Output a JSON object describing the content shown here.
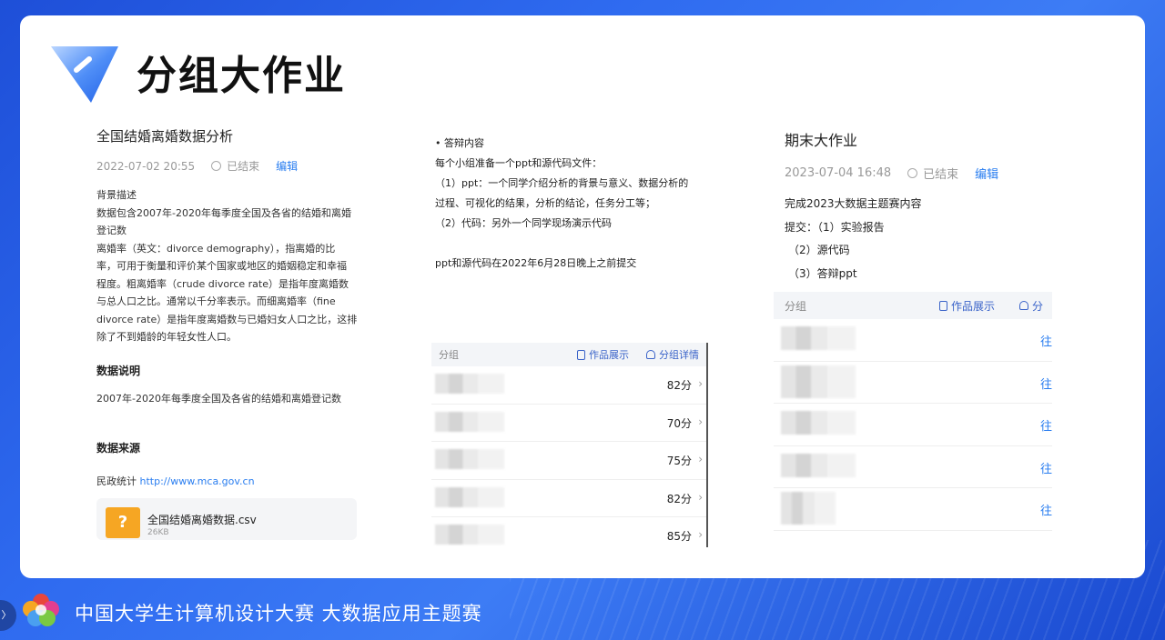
{
  "slide": {
    "title": "分组大作业"
  },
  "col1": {
    "project_title": "全国结婚离婚数据分析",
    "date": "2022-07-02 20:55",
    "status": "已结束",
    "edit_label": "编辑",
    "background_lines": [
      "背景描述",
      "数据包含2007年-2020年每季度全国及各省的结婚和离婚",
      "登记数",
      "离婚率（英文：divorce demography），指离婚的比",
      "率，可用于衡量和评价某个国家或地区的婚姻稳定和幸福",
      "程度。粗离婚率（crude divorce rate）是指年度离婚数",
      "与总人口之比。通常以千分率表示。而细离婚率（fine",
      "divorce rate）是指年度离婚数与已婚妇女人口之比，这排",
      "除了不到婚龄的年轻女性人口。"
    ],
    "data_desc_heading": "数据说明",
    "data_desc_text": "2007年-2020年每季度全国及各省的结婚和离婚登记数",
    "data_source_heading": "数据来源",
    "data_source_prefix": "民政统计",
    "data_source_url": "http://www.mca.gov.cn",
    "file": {
      "icon": "?",
      "name": "全国结婚离婚数据.csv",
      "size": "26KB"
    }
  },
  "col2": {
    "lines": [
      "• 答辩内容",
      "每个小组准备一个ppt和源代码文件：",
      "（1）ppt：一个同学介绍分析的背景与意义、数据分析的",
      "过程、可视化的结果，分析的结论，任务分工等；",
      "（2）代码：另外一个同学现场演示代码"
    ],
    "deadline": "ppt和源代码在2022年6月28日晚上之前提交",
    "table": {
      "col_group": "分组",
      "col_works": "作品展示",
      "col_details": "分组详情",
      "rows": [
        {
          "score": "82分"
        },
        {
          "score": "70分"
        },
        {
          "score": "75分"
        },
        {
          "score": "82分"
        },
        {
          "score": "85分"
        }
      ]
    }
  },
  "col3": {
    "project_title": "期末大作业",
    "date": "2023-07-04 16:48",
    "status": "已结束",
    "edit_label": "编辑",
    "lines": [
      "完成2023大数据主题赛内容",
      "提交：（1）实验报告",
      "（2）源代码",
      "（3）答辩ppt"
    ],
    "table": {
      "col_group": "分组",
      "col_works": "作品展示",
      "col_details_cut": "分",
      "row_cut_text": "往",
      "row_count": 5
    }
  },
  "footer": {
    "text": "中国大学生计算机设计大赛  大数据应用主题赛",
    "edge_button": "〉"
  }
}
